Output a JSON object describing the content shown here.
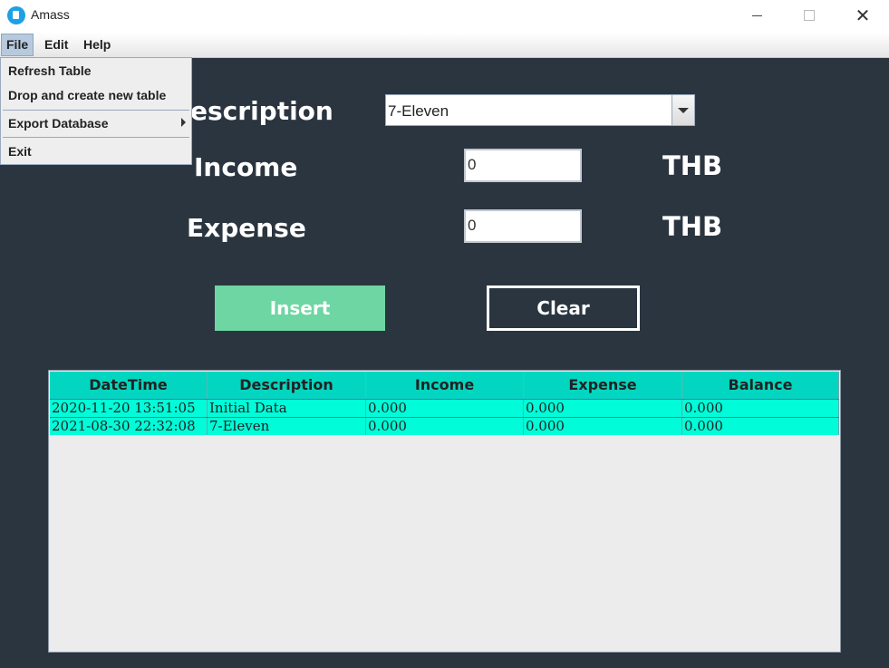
{
  "window": {
    "title": "Amass",
    "minimize": "",
    "maximize": "",
    "close": "✕"
  },
  "menubar": {
    "file": "File",
    "edit": "Edit",
    "help": "Help"
  },
  "file_menu": {
    "refresh": "Refresh Table",
    "drop_create": "Drop and create new table",
    "export": "Export Database",
    "exit": "Exit"
  },
  "form": {
    "description_label": "escription",
    "description_value": "7-Eleven",
    "income_label": "Income",
    "income_value": "0",
    "income_unit": "THB",
    "expense_label": "Expense",
    "expense_value": "0",
    "expense_unit": "THB",
    "insert_label": "Insert",
    "clear_label": "Clear"
  },
  "table": {
    "headers": [
      "DateTime",
      "Description",
      "Income",
      "Expense",
      "Balance"
    ],
    "rows": [
      [
        "2020-11-20 13:51:05",
        "Initial Data",
        "0.000",
        "0.000",
        "0.000"
      ],
      [
        "2021-08-30 22:32:08",
        "7-Eleven",
        "0.000",
        "0.000",
        "0.000"
      ]
    ]
  }
}
